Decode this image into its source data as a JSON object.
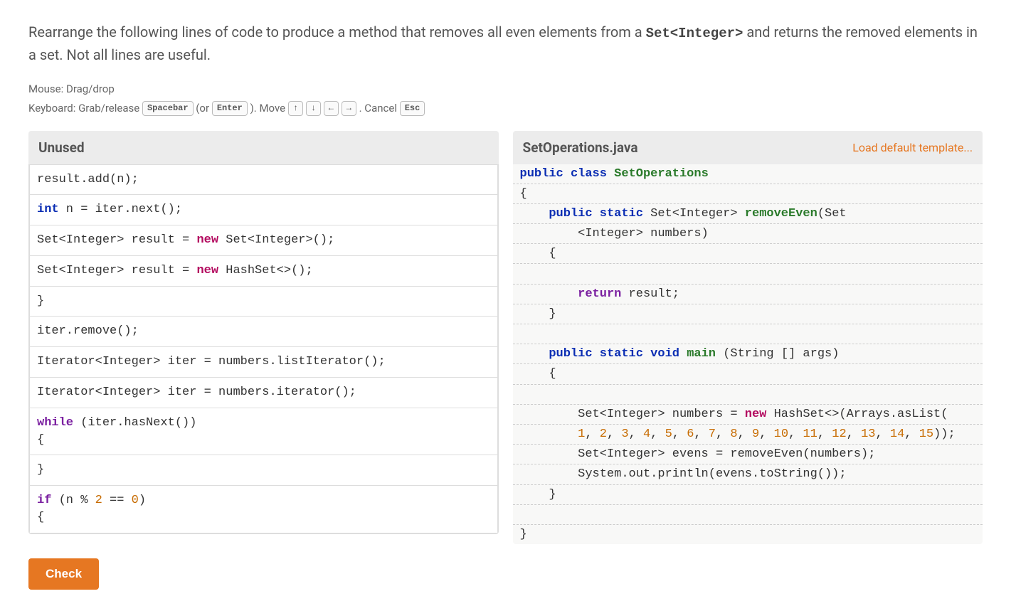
{
  "prompt": {
    "pre_code": "Rearrange the following lines of code to produce a method that removes all even elements from a ",
    "code": "Set<Integer>",
    "post_code": " and returns the removed elements in a set. Not all lines are useful."
  },
  "instructions": {
    "mouse_label": "Mouse: ",
    "mouse_action": "Drag/drop",
    "keyboard_label": "Keyboard: ",
    "keyboard_action": "Grab/release",
    "kbd_space": "Spacebar",
    "kbd_or": "(or",
    "kbd_enter": "Enter",
    "kbd_move": "). Move",
    "kbd_up": "↑",
    "kbd_down": "↓",
    "kbd_left": "←",
    "kbd_right": "→",
    "kbd_cancel_label": ". Cancel",
    "kbd_esc": "Esc"
  },
  "unused": {
    "title": "Unused",
    "tiles": [
      {
        "html": "result.add(n);"
      },
      {
        "html": "<span class='kw'>int</span> n = iter.next();"
      },
      {
        "html": "Set&lt;Integer&gt; result = <span class='new'>new</span> Set&lt;Integer&gt;();"
      },
      {
        "html": "Set&lt;Integer&gt; result = <span class='new'>new</span> HashSet&lt;&gt;();"
      },
      {
        "html": "}"
      },
      {
        "html": "iter.remove();"
      },
      {
        "html": "Iterator&lt;Integer&gt; iter = numbers.listIterator();"
      },
      {
        "html": "Iterator&lt;Integer&gt; iter = numbers.iterator();"
      },
      {
        "html": "<span class='while'>while</span> (iter.hasNext())\n{"
      },
      {
        "html": "}"
      },
      {
        "html": "<span class='while'>if</span> (n % <span class='num'>2</span> == <span class='num'>0</span>)\n{"
      }
    ]
  },
  "editor": {
    "title": "SetOperations.java",
    "load_link": "Load default template...",
    "lines": [
      {
        "indent": 0,
        "slot": false,
        "html": "<span class='kw'>public</span> <span class='kw'>class</span> <span class='cls'>SetOperations</span>"
      },
      {
        "indent": 0,
        "slot": true,
        "html": "{"
      },
      {
        "indent": 1,
        "slot": true,
        "html": "<span class='kw'>public</span> <span class='kw'>static</span> Set&lt;Integer&gt; <span class='cls'>removeEven</span>(Set"
      },
      {
        "indent": 2,
        "slot": true,
        "html": "&lt;Integer&gt; numbers)"
      },
      {
        "indent": 1,
        "slot": true,
        "html": "{"
      },
      {
        "indent": 2,
        "slot": true,
        "html": ""
      },
      {
        "indent": 2,
        "slot": true,
        "html": "<span class='while'>return</span> result;"
      },
      {
        "indent": 1,
        "slot": true,
        "html": "}"
      },
      {
        "indent": 1,
        "slot": true,
        "html": ""
      },
      {
        "indent": 1,
        "slot": true,
        "html": "<span class='kw'>public</span> <span class='kw'>static</span> <span class='kw'>void</span> <span class='cls'>main</span> (String [] args)"
      },
      {
        "indent": 1,
        "slot": true,
        "html": "{"
      },
      {
        "indent": 2,
        "slot": true,
        "html": ""
      },
      {
        "indent": 2,
        "slot": true,
        "html": "Set&lt;Integer&gt; numbers = <span class='new'>new</span> HashSet&lt;&gt;(Arrays.asList("
      },
      {
        "indent": 2,
        "slot": true,
        "html": "<span class='num'>1</span>, <span class='num'>2</span>, <span class='num'>3</span>, <span class='num'>4</span>, <span class='num'>5</span>, <span class='num'>6</span>, <span class='num'>7</span>, <span class='num'>8</span>, <span class='num'>9</span>, <span class='num'>10</span>, <span class='num'>11</span>, <span class='num'>12</span>, <span class='num'>13</span>, <span class='num'>14</span>, <span class='num'>15</span>));"
      },
      {
        "indent": 2,
        "slot": true,
        "html": "Set&lt;Integer&gt; evens = removeEven(numbers);"
      },
      {
        "indent": 2,
        "slot": true,
        "html": "System.out.println(evens.toString());"
      },
      {
        "indent": 1,
        "slot": true,
        "html": "}"
      },
      {
        "indent": 0,
        "slot": true,
        "html": ""
      },
      {
        "indent": 0,
        "slot": false,
        "html": "}"
      }
    ]
  },
  "buttons": {
    "check": "Check"
  }
}
